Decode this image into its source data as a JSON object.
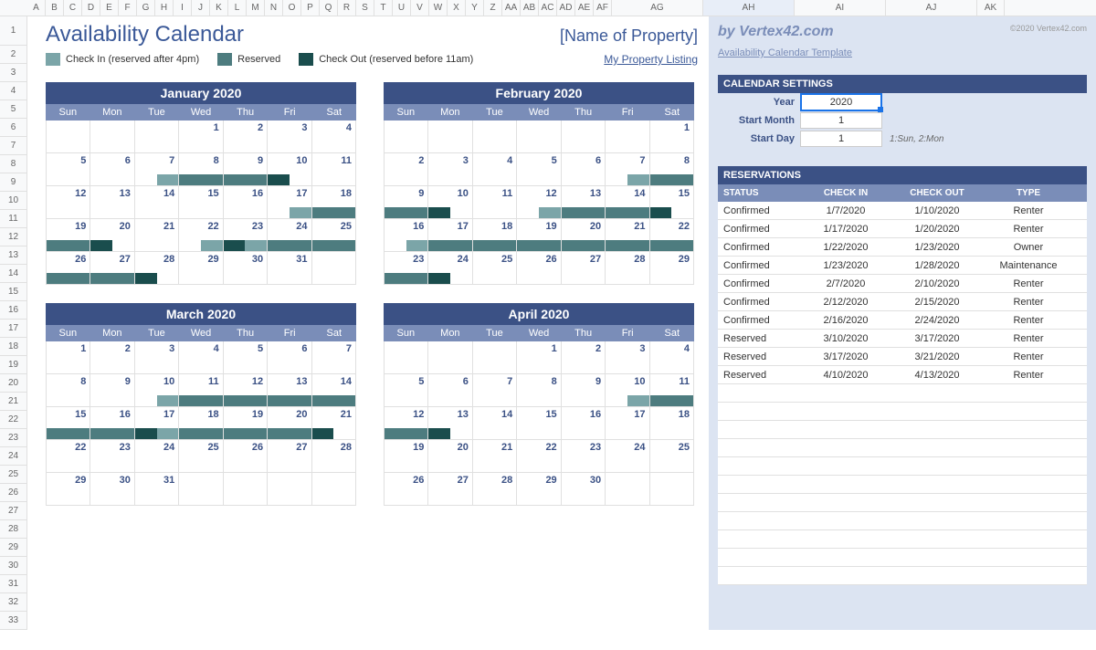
{
  "cols": [
    "A",
    "B",
    "C",
    "D",
    "E",
    "F",
    "G",
    "H",
    "I",
    "J",
    "K",
    "L",
    "M",
    "N",
    "O",
    "P",
    "Q",
    "R",
    "S",
    "T",
    "U",
    "V",
    "W",
    "X",
    "Y",
    "Z",
    "AA",
    "AB",
    "AC",
    "AD",
    "AE",
    "AF",
    "AG",
    "AH",
    "AI",
    "AJ",
    "AK"
  ],
  "title": "Availability Calendar",
  "property": "[Name of Property]",
  "legend": {
    "checkin": "Check In (reserved after 4pm)",
    "reserved": "Reserved",
    "checkout": "Check Out (reserved before 11am)"
  },
  "listing_link": "My Property Listing",
  "brand": "by Vertex42.com",
  "copyright": "©2020 Vertex42.com",
  "template_link": "Availability Calendar Template",
  "settings_hdr": "CALENDAR SETTINGS",
  "settings": {
    "year_lbl": "Year",
    "year_val": "2020",
    "month_lbl": "Start Month",
    "month_val": "1",
    "day_lbl": "Start Day",
    "day_val": "1",
    "day_note": "1:Sun, 2:Mon"
  },
  "res_hdr": "RESERVATIONS",
  "res_cols": {
    "status": "STATUS",
    "checkin": "CHECK IN",
    "checkout": "CHECK OUT",
    "type": "TYPE"
  },
  "dow": [
    "Sun",
    "Mon",
    "Tue",
    "Wed",
    "Thu",
    "Fri",
    "Sat"
  ],
  "reservations": [
    {
      "status": "Confirmed",
      "checkin": "1/7/2020",
      "checkout": "1/10/2020",
      "type": "Renter"
    },
    {
      "status": "Confirmed",
      "checkin": "1/17/2020",
      "checkout": "1/20/2020",
      "type": "Renter"
    },
    {
      "status": "Confirmed",
      "checkin": "1/22/2020",
      "checkout": "1/23/2020",
      "type": "Owner"
    },
    {
      "status": "Confirmed",
      "checkin": "1/23/2020",
      "checkout": "1/28/2020",
      "type": "Maintenance"
    },
    {
      "status": "Confirmed",
      "checkin": "2/7/2020",
      "checkout": "2/10/2020",
      "type": "Renter"
    },
    {
      "status": "Confirmed",
      "checkin": "2/12/2020",
      "checkout": "2/15/2020",
      "type": "Renter"
    },
    {
      "status": "Confirmed",
      "checkin": "2/16/2020",
      "checkout": "2/24/2020",
      "type": "Renter"
    },
    {
      "status": "Reserved",
      "checkin": "3/10/2020",
      "checkout": "3/17/2020",
      "type": "Renter"
    },
    {
      "status": "Reserved",
      "checkin": "3/17/2020",
      "checkout": "3/21/2020",
      "type": "Renter"
    },
    {
      "status": "Reserved",
      "checkin": "4/10/2020",
      "checkout": "4/13/2020",
      "type": "Renter"
    }
  ],
  "months": [
    {
      "name": "January 2020",
      "start": 3,
      "days": 31,
      "bars": {
        "7": "in",
        "8": "res",
        "9": "res",
        "10": "out",
        "17": "in",
        "18": "res",
        "19": "res",
        "20": "out",
        "22": "in",
        "23": "split",
        "24": "res",
        "25": "res",
        "26": "res",
        "27": "res",
        "28": "out"
      }
    },
    {
      "name": "February 2020",
      "start": 6,
      "days": 29,
      "bars": {
        "7": "in",
        "8": "res",
        "9": "res",
        "10": "out",
        "12": "in",
        "13": "res",
        "14": "res",
        "15": "out",
        "16": "in",
        "17": "res",
        "18": "res",
        "19": "res",
        "20": "res",
        "21": "res",
        "22": "res",
        "23": "res",
        "24": "out"
      }
    },
    {
      "name": "March 2020",
      "start": 0,
      "days": 31,
      "bars": {
        "10": "in",
        "11": "res",
        "12": "res",
        "13": "res",
        "14": "res",
        "15": "res",
        "16": "res",
        "17": "split",
        "18": "res",
        "19": "res",
        "20": "res",
        "21": "out"
      }
    },
    {
      "name": "April 2020",
      "start": 3,
      "days": 30,
      "bars": {
        "10": "in",
        "11": "res",
        "12": "res",
        "13": "out"
      }
    }
  ]
}
